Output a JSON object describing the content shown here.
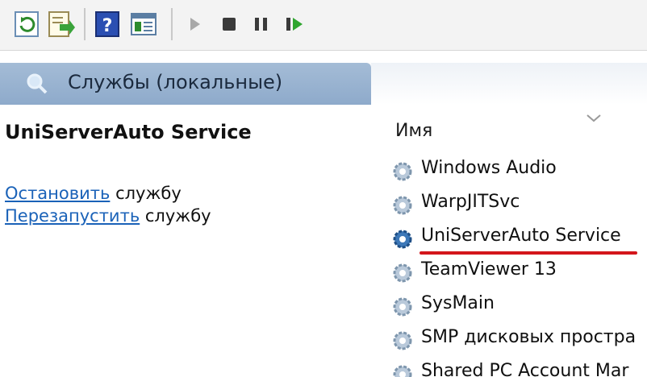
{
  "toolbar": {
    "items": [
      {
        "name": "refresh-icon"
      },
      {
        "name": "export-list-icon"
      },
      {
        "name": "help-icon"
      },
      {
        "name": "show-hide-console-tree-icon"
      },
      {
        "name": "start-service-icon"
      },
      {
        "name": "stop-service-icon"
      },
      {
        "name": "pause-service-icon"
      },
      {
        "name": "resume-service-icon"
      }
    ]
  },
  "scope": {
    "label": "Службы (локальные)",
    "icon": "search-services-icon"
  },
  "description": {
    "service_title": "UniServerAuto Service",
    "stop_link": "Остановить",
    "stop_suffix": " службу",
    "restart_link": "Перезапустить",
    "restart_suffix": " службу"
  },
  "list": {
    "column_name": "Имя",
    "rows": [
      {
        "name": "Windows Audio"
      },
      {
        "name": "WarpJITSvc"
      },
      {
        "name": "UniServerAuto Service"
      },
      {
        "name": "TeamViewer 13"
      },
      {
        "name": "SysMain"
      },
      {
        "name": "SMP дисковых простра"
      },
      {
        "name": "Shared PC Account Mar"
      }
    ]
  },
  "colors": {
    "header_tab": "#8eaacb",
    "link": "#1a62b8",
    "highlight_underline": "#d3161b"
  }
}
